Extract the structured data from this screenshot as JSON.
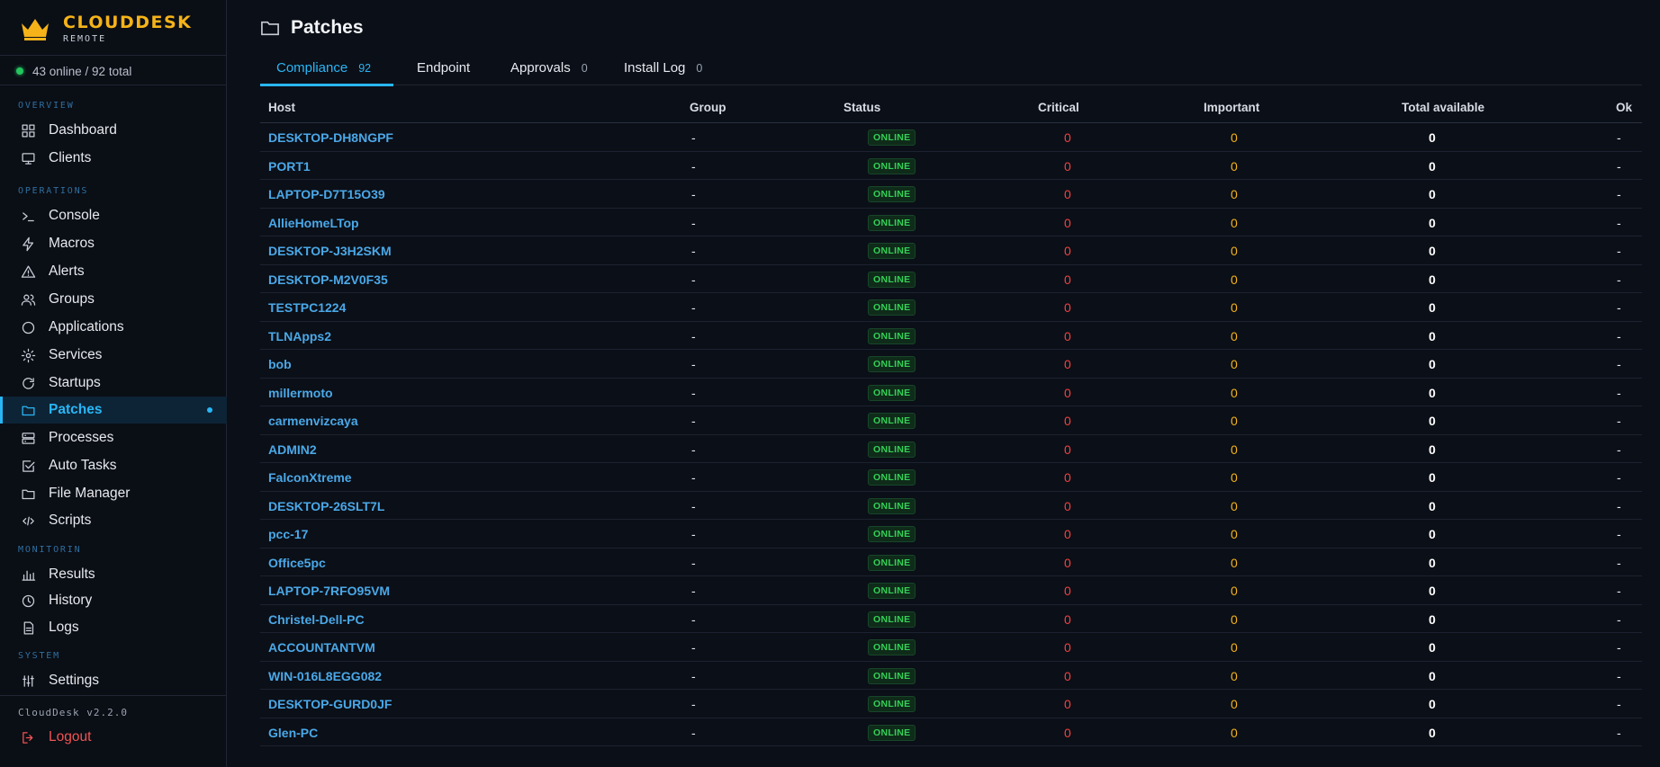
{
  "brand": {
    "name": "CLOUDDESK",
    "sub": "REMOTE"
  },
  "status_summary": "43 online / 92 total",
  "sections": {
    "overview": "OVERVIEW",
    "operations": "OPERATIONS",
    "monitoring": "MONITORIN",
    "system": "SYSTEM"
  },
  "nav": {
    "dashboard": "Dashboard",
    "clients": "Clients",
    "console": "Console",
    "macros": "Macros",
    "alerts": "Alerts",
    "groups": "Groups",
    "applications": "Applications",
    "services": "Services",
    "startups": "Startups",
    "patches": "Patches",
    "processes": "Processes",
    "auto_tasks": "Auto Tasks",
    "file_manager": "File Manager",
    "scripts": "Scripts",
    "results": "Results",
    "history": "History",
    "logs": "Logs",
    "settings": "Settings",
    "logout": "Logout"
  },
  "version": "CloudDesk v2.2.0",
  "page": {
    "title": "Patches"
  },
  "tabs": [
    {
      "label": "Compliance",
      "count": "92"
    },
    {
      "label": "Endpoint",
      "count": ""
    },
    {
      "label": "Approvals",
      "count": "0"
    },
    {
      "label": "Install Log",
      "count": "0"
    }
  ],
  "table": {
    "headers": {
      "host": "Host",
      "group": "Group",
      "status": "Status",
      "critical": "Critical",
      "important": "Important",
      "total": "Total available",
      "ok": "Ok"
    },
    "rows": [
      {
        "host": "DESKTOP-DH8NGPF",
        "group": "-",
        "status": "ONLINE",
        "critical": "0",
        "important": "0",
        "total": "0",
        "ok": "-"
      },
      {
        "host": "PORT1",
        "group": "-",
        "status": "ONLINE",
        "critical": "0",
        "important": "0",
        "total": "0",
        "ok": "-"
      },
      {
        "host": "LAPTOP-D7T15O39",
        "group": "-",
        "status": "ONLINE",
        "critical": "0",
        "important": "0",
        "total": "0",
        "ok": "-"
      },
      {
        "host": "AllieHomeLTop",
        "group": "-",
        "status": "ONLINE",
        "critical": "0",
        "important": "0",
        "total": "0",
        "ok": "-"
      },
      {
        "host": "DESKTOP-J3H2SKM",
        "group": "-",
        "status": "ONLINE",
        "critical": "0",
        "important": "0",
        "total": "0",
        "ok": "-"
      },
      {
        "host": "DESKTOP-M2V0F35",
        "group": "-",
        "status": "ONLINE",
        "critical": "0",
        "important": "0",
        "total": "0",
        "ok": "-"
      },
      {
        "host": "TESTPC1224",
        "group": "-",
        "status": "ONLINE",
        "critical": "0",
        "important": "0",
        "total": "0",
        "ok": "-"
      },
      {
        "host": "TLNApps2",
        "group": "-",
        "status": "ONLINE",
        "critical": "0",
        "important": "0",
        "total": "0",
        "ok": "-"
      },
      {
        "host": "bob",
        "group": "-",
        "status": "ONLINE",
        "critical": "0",
        "important": "0",
        "total": "0",
        "ok": "-"
      },
      {
        "host": "millermoto",
        "group": "-",
        "status": "ONLINE",
        "critical": "0",
        "important": "0",
        "total": "0",
        "ok": "-"
      },
      {
        "host": "carmenvizcaya",
        "group": "-",
        "status": "ONLINE",
        "critical": "0",
        "important": "0",
        "total": "0",
        "ok": "-"
      },
      {
        "host": "ADMIN2",
        "group": "-",
        "status": "ONLINE",
        "critical": "0",
        "important": "0",
        "total": "0",
        "ok": "-"
      },
      {
        "host": "FalconXtreme",
        "group": "-",
        "status": "ONLINE",
        "critical": "0",
        "important": "0",
        "total": "0",
        "ok": "-"
      },
      {
        "host": "DESKTOP-26SLT7L",
        "group": "-",
        "status": "ONLINE",
        "critical": "0",
        "important": "0",
        "total": "0",
        "ok": "-"
      },
      {
        "host": "pcc-17",
        "group": "-",
        "status": "ONLINE",
        "critical": "0",
        "important": "0",
        "total": "0",
        "ok": "-"
      },
      {
        "host": "Office5pc",
        "group": "-",
        "status": "ONLINE",
        "critical": "0",
        "important": "0",
        "total": "0",
        "ok": "-"
      },
      {
        "host": "LAPTOP-7RFO95VM",
        "group": "-",
        "status": "ONLINE",
        "critical": "0",
        "important": "0",
        "total": "0",
        "ok": "-"
      },
      {
        "host": "Christel-Dell-PC",
        "group": "-",
        "status": "ONLINE",
        "critical": "0",
        "important": "0",
        "total": "0",
        "ok": "-"
      },
      {
        "host": "ACCOUNTANTVM",
        "group": "-",
        "status": "ONLINE",
        "critical": "0",
        "important": "0",
        "total": "0",
        "ok": "-"
      },
      {
        "host": "WIN-016L8EGG082",
        "group": "-",
        "status": "ONLINE",
        "critical": "0",
        "important": "0",
        "total": "0",
        "ok": "-"
      },
      {
        "host": "DESKTOP-GURD0JF",
        "group": "-",
        "status": "ONLINE",
        "critical": "0",
        "important": "0",
        "total": "0",
        "ok": "-"
      },
      {
        "host": "Glen-PC",
        "group": "-",
        "status": "ONLINE",
        "critical": "0",
        "important": "0",
        "total": "0",
        "ok": "-"
      }
    ]
  },
  "colors": {
    "accent": "#29b6f6",
    "critical": "#ef4444",
    "important": "#f5b319",
    "online": "#34d058",
    "brand": "#f5b319"
  }
}
